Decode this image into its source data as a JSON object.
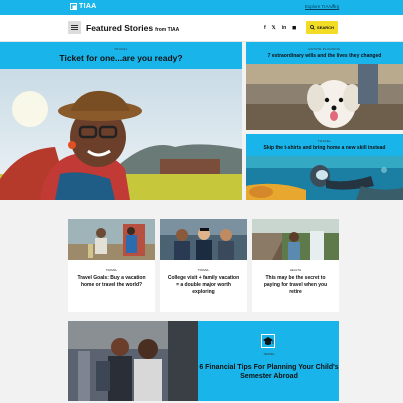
{
  "brand": {
    "name": "TIAA"
  },
  "topbar": {
    "explore_label": "Explore TIAA.org",
    "explore_arrow": "↗"
  },
  "header": {
    "title": "Featured Stories",
    "title_from": "from TIAA",
    "social": [
      "f",
      "𝕏",
      "in",
      "◼"
    ],
    "search_label": "SEARCH"
  },
  "hero": {
    "tag": "TRAVEL",
    "title": "Ticket for one...are you ready?"
  },
  "side_cards": [
    {
      "tag": "ESTATE PLANNING",
      "title": "7 extraordinary wills and the lives they changed"
    },
    {
      "tag": "TRAVEL",
      "title": "Skip the t-shirts and bring home a new skill instead"
    }
  ],
  "cards": [
    {
      "tag": "TRAVEL",
      "title": "Travel Goals: Buy a vacation home or travel the world?"
    },
    {
      "tag": "TRAVEL",
      "title": "College visit + family vacation = a double major worth exploring"
    },
    {
      "tag": "HEALTH",
      "title": "This may be the secret to paying for travel when you retire"
    }
  ],
  "promo": {
    "tag": "TRAVEL",
    "title": "6 Financial Tips For Planning Your Child's Semester Abroad"
  },
  "colors": {
    "accent": "#18b4ea",
    "search": "#f2dc26",
    "background": "#f2f2f2"
  }
}
